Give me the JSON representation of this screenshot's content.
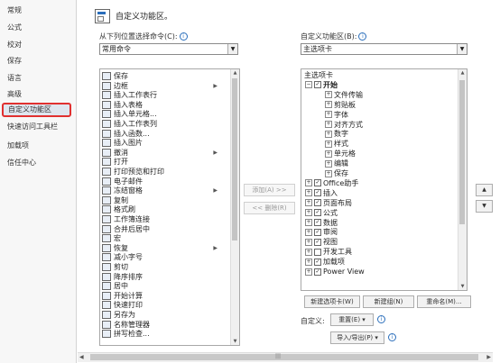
{
  "sidebar": {
    "items": [
      {
        "label": "常规"
      },
      {
        "label": "公式"
      },
      {
        "label": "校对"
      },
      {
        "label": "保存"
      },
      {
        "label": "语言"
      },
      {
        "label": "高级"
      },
      {
        "label": "自定义功能区",
        "selected": true
      },
      {
        "label": "快速访问工具栏"
      },
      {
        "label": "加载项"
      },
      {
        "label": "信任中心"
      }
    ]
  },
  "header": {
    "title": "自定义功能区。"
  },
  "left": {
    "label": "从下列位置选择命令(C):",
    "combo_value": "常用命令",
    "commands": [
      {
        "label": "保存",
        "icon": "save-icon"
      },
      {
        "label": "边框",
        "icon": "border-icon",
        "submenu": true
      },
      {
        "label": "插入工作表行",
        "icon": "insert-row-icon"
      },
      {
        "label": "插入表格",
        "icon": "insert-table-icon"
      },
      {
        "label": "插入单元格...",
        "icon": "insert-cell-icon"
      },
      {
        "label": "插入工作表列",
        "icon": "insert-column-icon"
      },
      {
        "label": "插入函数...",
        "icon": "function-icon"
      },
      {
        "label": "插入图片",
        "icon": "picture-icon"
      },
      {
        "label": "撤消",
        "icon": "undo-icon",
        "submenu": true
      },
      {
        "label": "打开",
        "icon": "open-icon"
      },
      {
        "label": "打印预览和打印",
        "icon": "print-preview-icon"
      },
      {
        "label": "电子邮件",
        "icon": "email-icon"
      },
      {
        "label": "冻结窗格",
        "icon": "freeze-panes-icon",
        "submenu": true
      },
      {
        "label": "复制",
        "icon": "copy-icon"
      },
      {
        "label": "格式刷",
        "icon": "format-painter-icon"
      },
      {
        "label": "工作簿连接",
        "icon": "connection-icon"
      },
      {
        "label": "合并后居中",
        "icon": "merge-center-icon"
      },
      {
        "label": "宏",
        "icon": "macro-icon"
      },
      {
        "label": "恢复",
        "icon": "redo-icon",
        "submenu": true
      },
      {
        "label": "减小字号",
        "icon": "font-decrease-icon"
      },
      {
        "label": "剪切",
        "icon": "cut-icon"
      },
      {
        "label": "降序排序",
        "icon": "sort-descending-icon"
      },
      {
        "label": "居中",
        "icon": "center-icon"
      },
      {
        "label": "开始计算",
        "icon": "calculate-icon"
      },
      {
        "label": "快速打印",
        "icon": "quick-print-icon"
      },
      {
        "label": "另存为",
        "icon": "save-as-icon"
      },
      {
        "label": "名称管理器",
        "icon": "name-manager-icon"
      },
      {
        "label": "拼写检查...",
        "icon": "spelling-icon"
      }
    ]
  },
  "middle": {
    "add_label": "添加(A) >>",
    "remove_label": "<< 删除(R)"
  },
  "right": {
    "label": "自定义功能区(B):",
    "combo_value": "主选项卡",
    "tree": [
      {
        "label": "主选项卡",
        "level": -1
      },
      {
        "label": "开始",
        "level": 0,
        "exp": "⊟",
        "chk": true,
        "bold": true
      },
      {
        "label": "文件传输",
        "level": 1,
        "exp": "⊞"
      },
      {
        "label": "剪贴板",
        "level": 1,
        "exp": "⊞"
      },
      {
        "label": "字体",
        "level": 1,
        "exp": "⊞"
      },
      {
        "label": "对齐方式",
        "level": 1,
        "exp": "⊞"
      },
      {
        "label": "数字",
        "level": 1,
        "exp": "⊞"
      },
      {
        "label": "样式",
        "level": 1,
        "exp": "⊞"
      },
      {
        "label": "单元格",
        "level": 1,
        "exp": "⊞"
      },
      {
        "label": "编辑",
        "level": 1,
        "exp": "⊞"
      },
      {
        "label": "保存",
        "level": 1,
        "exp": "⊞"
      },
      {
        "label": "Office助手",
        "level": 0,
        "exp": "⊞",
        "chk": true
      },
      {
        "label": "插入",
        "level": 0,
        "exp": "⊞",
        "chk": true
      },
      {
        "label": "页面布局",
        "level": 0,
        "exp": "⊞",
        "chk": true
      },
      {
        "label": "公式",
        "level": 0,
        "exp": "⊞",
        "chk": true
      },
      {
        "label": "数据",
        "level": 0,
        "exp": "⊞",
        "chk": true
      },
      {
        "label": "审阅",
        "level": 0,
        "exp": "⊞",
        "chk": true
      },
      {
        "label": "视图",
        "level": 0,
        "exp": "⊞",
        "chk": true
      },
      {
        "label": "开发工具",
        "level": 0,
        "exp": "⊞",
        "chk": false
      },
      {
        "label": "加载项",
        "level": 0,
        "exp": "⊞",
        "chk": true
      },
      {
        "label": "Power View",
        "level": 0,
        "exp": "⊞",
        "chk": true
      }
    ],
    "new_tab_label": "新建选项卡(W)",
    "new_group_label": "新建组(N)",
    "rename_label": "重命名(M)...",
    "customize_label": "自定义:",
    "reset_label": "重置(E) ▾",
    "import_export_label": "导入/导出(P) ▾"
  },
  "glyphs": {
    "check": "✓",
    "dropdown": "▼",
    "up": "▲",
    "down": "▼",
    "left": "◀",
    "right": "▶",
    "submenu": "▶",
    "info": "i",
    "hscroll_grip": "|||"
  }
}
